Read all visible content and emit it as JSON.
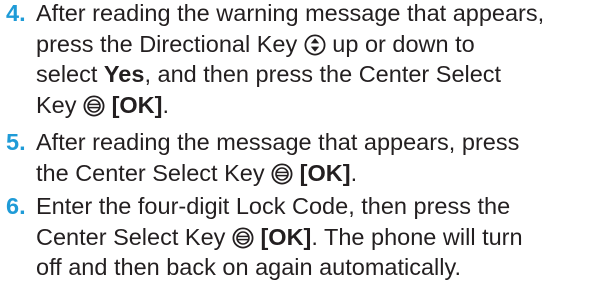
{
  "steps": [
    {
      "number": "4.",
      "lines": [
        {
          "pre": "After reading the warning message that appears,"
        },
        {
          "pre": "press the Directional Key",
          "icon": "directional-key-icon",
          "post": " up or down to"
        },
        {
          "pre": "select ",
          "bold": "Yes",
          "post": ", and then press the Center Select"
        },
        {
          "pre": "Key",
          "icon": "center-select-key-icon",
          "bold": "[OK]",
          "post": "."
        }
      ]
    },
    {
      "number": "5.",
      "lines": [
        {
          "pre": "After reading the message that appears, press"
        },
        {
          "pre": "the Center Select Key",
          "icon": "center-select-key-icon",
          "bold": "[OK]",
          "post": "."
        }
      ]
    },
    {
      "number": "6.",
      "lines": [
        {
          "pre": "Enter the four-digit Lock Code, then press the"
        },
        {
          "pre": "Center Select Key",
          "icon": "center-select-key-icon",
          "bold": "[OK]",
          "post": ". The phone will turn"
        },
        {
          "pre": "off and then back on again automatically."
        }
      ]
    }
  ],
  "colors": {
    "step_number": "#1f9bd7",
    "text": "#231f20"
  }
}
